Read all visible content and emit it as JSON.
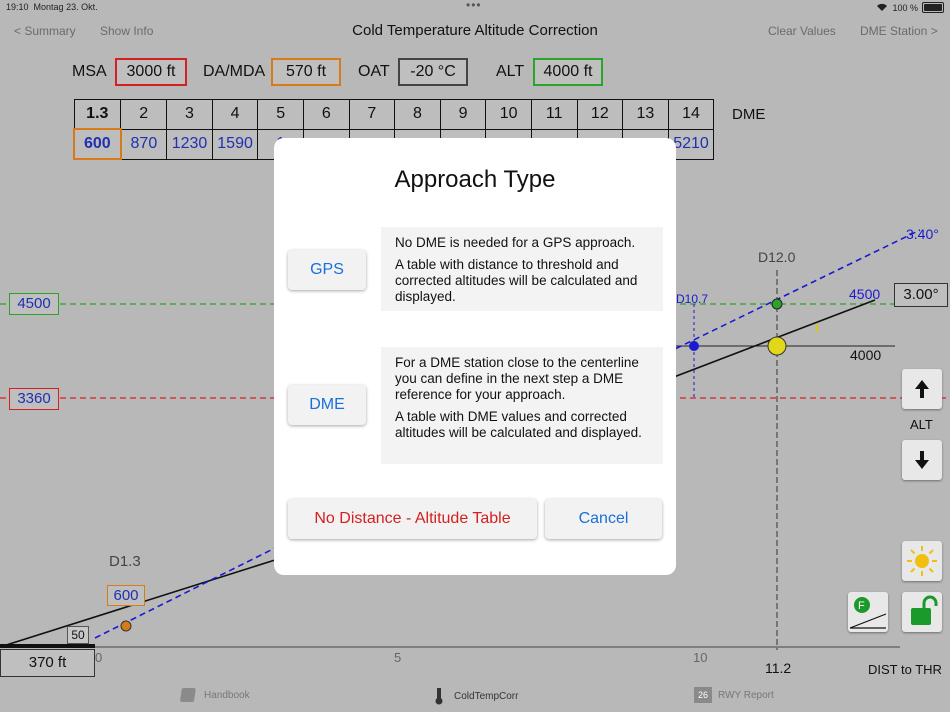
{
  "status_bar": {
    "time": "19:10",
    "date": "Montag 23. Okt.",
    "dots": "•••",
    "battery": "100 %"
  },
  "nav": {
    "back": "< Summary",
    "show_info": "Show Info",
    "title": "Cold Temperature Altitude Correction",
    "clear": "Clear Values",
    "dme_station": "DME Station >"
  },
  "values": {
    "msa_label": "MSA",
    "msa": "3000 ft",
    "damda_label": "DA/MDA",
    "damda": "570 ft",
    "oat_label": "OAT",
    "oat": "-20 °C",
    "alt_label": "ALT",
    "alt": "4000 ft"
  },
  "dme_table": {
    "label": "DME",
    "headers": [
      "1.3",
      "2",
      "3",
      "4",
      "5",
      "6",
      "7",
      "8",
      "9",
      "10",
      "11",
      "12",
      "13",
      "14"
    ],
    "values": [
      "600",
      "870",
      "1230",
      "1590",
      "1",
      "",
      "",
      "",
      "",
      "",
      "",
      "",
      "",
      "5210"
    ]
  },
  "chart": {
    "alt_4500": "4500",
    "alt_3360": "3360",
    "d12_label": "D12.0",
    "d107_label": "D10.7",
    "angle_340": "3.40°",
    "angle_300": "3.00°",
    "line_4500": "4500",
    "line_4000": "4000",
    "d13_label": "D1.3",
    "d13_value": "600",
    "marker_50": "50",
    "thr_alt": "370 ft",
    "x_ticks": [
      "0",
      "5",
      "10"
    ],
    "x_dist": "11.2",
    "x_axis": "DIST to THR",
    "alt_button_label": "ALT",
    "colors": {
      "green": "#2aa52a",
      "red": "#d42020",
      "blue": "#1a1ad0",
      "orange": "#d87a1a"
    }
  },
  "modal": {
    "title": "Approach Type",
    "gps_button": "GPS",
    "gps_desc_1": "No DME is needed for a GPS approach.",
    "gps_desc_2": "A table with distance to threshold and corrected altitudes will be calculated and displayed.",
    "dme_button": "DME",
    "dme_desc_1": "For a DME station close to the centerline you can define in the next step a DME reference for your approach.",
    "dme_desc_2": "A table with DME values and corrected altitudes will be calculated and displayed.",
    "no_distance": "No Distance - Altitude Table",
    "cancel": "Cancel"
  },
  "tabs": [
    {
      "label": "Handbook",
      "icon": "book-icon"
    },
    {
      "label": "ColdTempCorr",
      "icon": "thermometer-icon"
    },
    {
      "label": "RWY Report",
      "icon": "calendar-icon",
      "badge": "26"
    }
  ]
}
